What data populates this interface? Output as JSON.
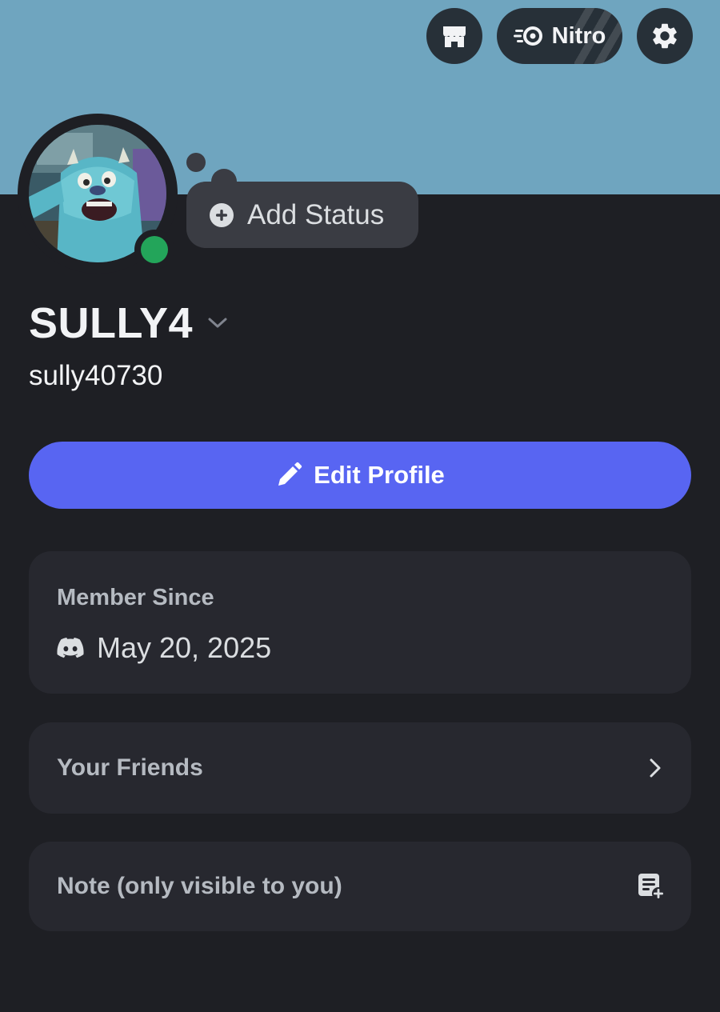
{
  "header": {
    "nitro_label": "Nitro",
    "icons": {
      "shop": "shop-icon",
      "nitro": "nitro-icon",
      "settings": "gear-icon"
    }
  },
  "colors": {
    "banner": "#6fa5bf",
    "background": "#1e1f24",
    "card": "#27282f",
    "accent": "#5865f2",
    "online": "#23a55a"
  },
  "profile": {
    "status_prompt": "Add Status",
    "display_name": "SULLY4",
    "username": "sully40730",
    "online_status": "online",
    "edit_button": "Edit Profile"
  },
  "member_since": {
    "heading": "Member Since",
    "date": "May 20, 2025",
    "icon": "discord-icon"
  },
  "friends": {
    "label": "Your Friends",
    "icon": "chevron-right-icon"
  },
  "note": {
    "label": "Note (only visible to you)",
    "icon": "add-note-icon"
  }
}
